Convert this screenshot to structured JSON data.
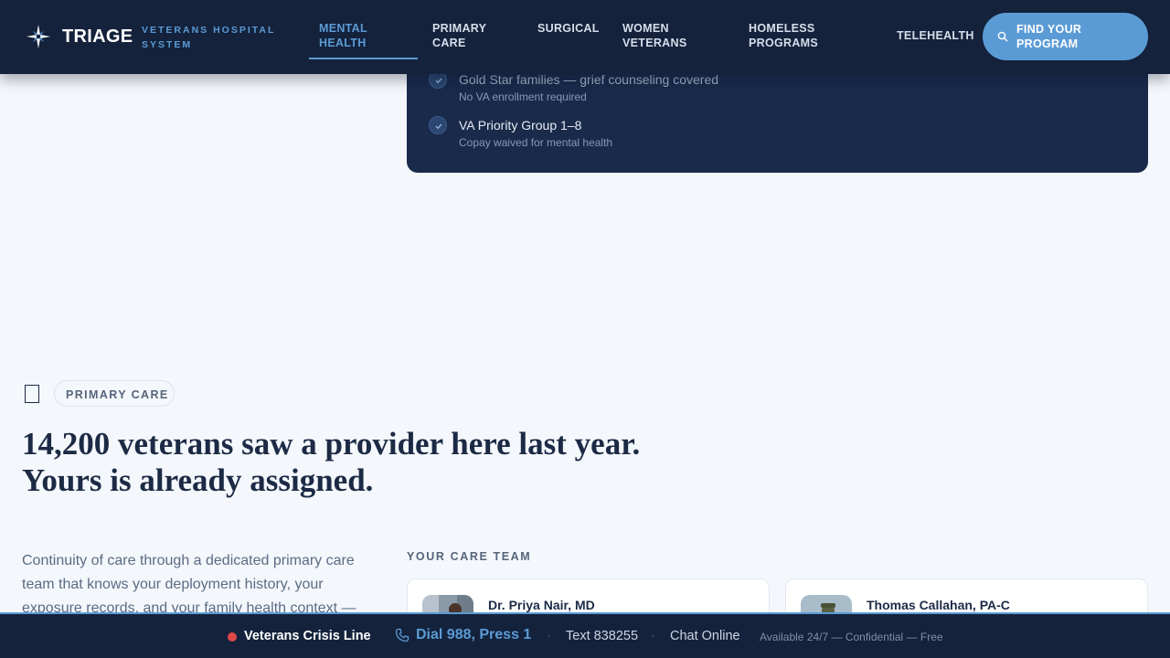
{
  "header": {
    "brand": "TRIAGE",
    "subbrand": "VETERANS HOSPITAL SYSTEM",
    "nav": [
      {
        "label": "MENTAL HEALTH",
        "active": true
      },
      {
        "label": "PRIMARY CARE",
        "active": false
      },
      {
        "label": "SURGICAL",
        "active": false
      },
      {
        "label": "WOMEN VETERANS",
        "active": false
      },
      {
        "label": "HOMELESS PROGRAMS",
        "active": false
      },
      {
        "label": "TELEHEALTH",
        "active": false
      }
    ],
    "cta_label": "FIND YOUR PROGRAM"
  },
  "eligibility": {
    "items": [
      {
        "title": "Gold Star families — grief counseling covered",
        "sub": "No VA enrollment required"
      },
      {
        "title": "VA Priority Group 1–8",
        "sub": "Copay waived for mental health"
      }
    ]
  },
  "primary_care": {
    "tag": "PRIMARY CARE",
    "headline_line1": "14,200 veterans saw a provider here last year.",
    "headline_line2": "Yours is already assigned.",
    "lead": "Continuity of care through a dedicated primary care team that knows your deployment history, your exposure records, and your family health context —",
    "team_label": "YOUR CARE TEAM",
    "team": [
      {
        "name": "Dr. Priya Nair, MD"
      },
      {
        "name": "Thomas Callahan, PA-C"
      }
    ]
  },
  "crisis_bar": {
    "title": "Veterans Crisis Line",
    "dial": "Dial 988, Press 1",
    "text": "Text 838255",
    "chat": "Chat Online",
    "note": "Available 24/7 — Confidential — Free",
    "separator": "·"
  },
  "colors": {
    "navy": "#14223c",
    "card_navy": "#1a2a4a",
    "accent": "#5b9bd5",
    "alert": "#e04848",
    "page_bg": "#f4f7fb"
  },
  "icons": {
    "logo": "compass-star-icon",
    "cta": "search-icon",
    "check": "check-icon",
    "section": "document-icon",
    "phone": "phone-icon"
  }
}
